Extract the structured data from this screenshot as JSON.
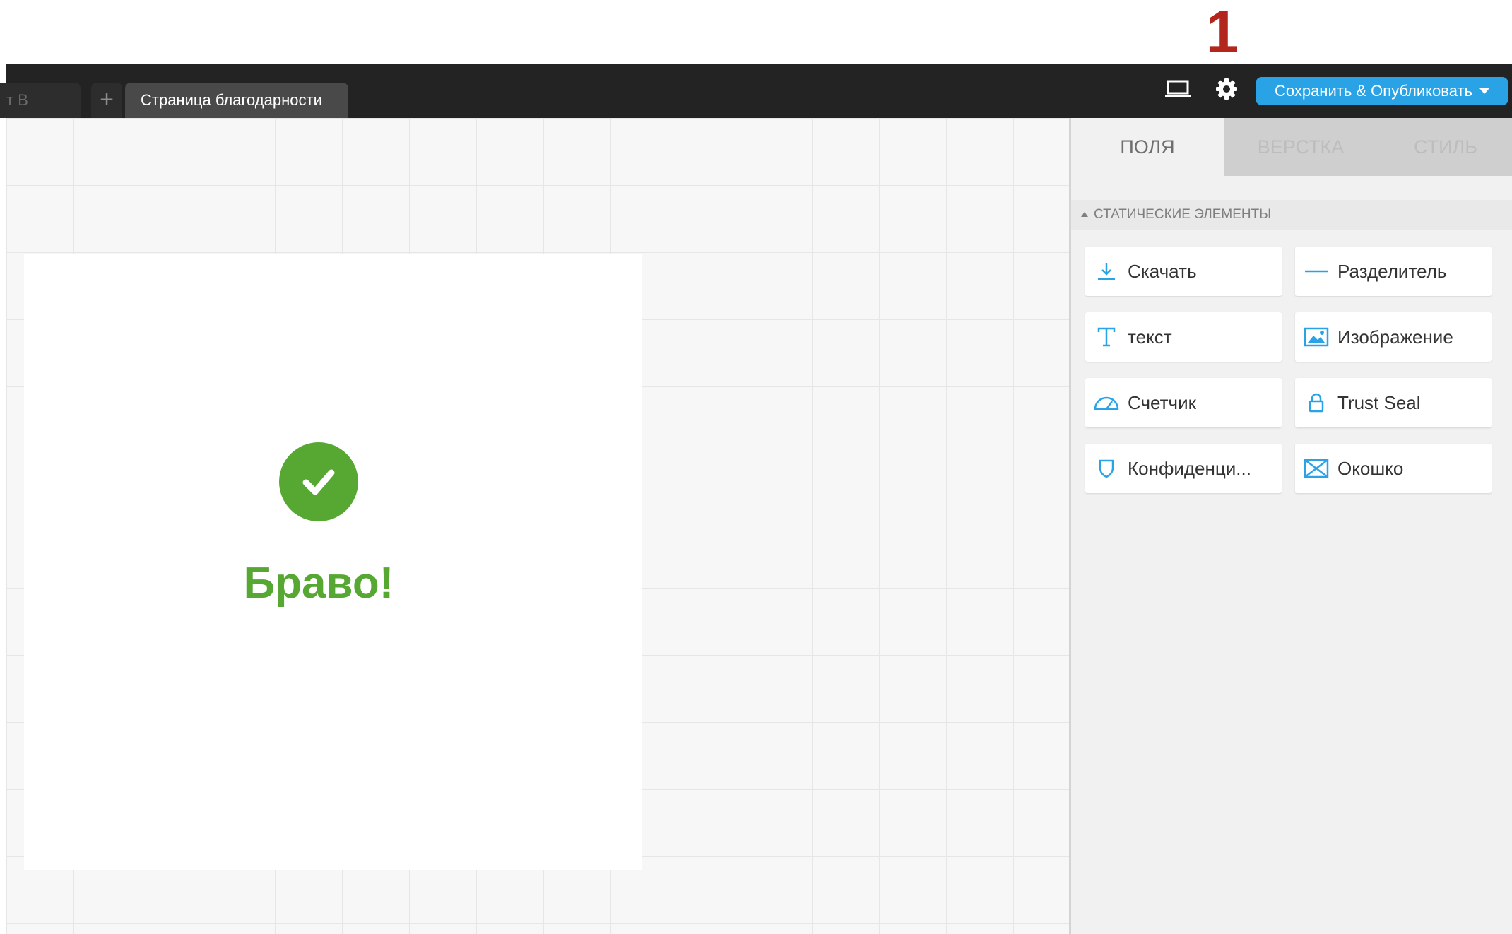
{
  "annotation": {
    "number": "1",
    "color": "#c62828"
  },
  "topbar": {
    "tabs": [
      {
        "label": "т В"
      },
      {
        "label": "+"
      },
      {
        "label": "Страница благодарности"
      }
    ],
    "publish_label": "Сохранить & Опубликовать",
    "icons": [
      "laptop-icon",
      "gear-icon",
      "caret-down-icon"
    ],
    "accent": "#2aa3e6"
  },
  "canvas": {
    "heading": "Браво!",
    "success_color": "#56a832"
  },
  "panel": {
    "tabs": [
      "ПОЛЯ",
      "ВЕРСТКА",
      "СТИЛЬ"
    ],
    "active_tab": "ПОЛЯ",
    "section_title": "СТАТИЧЕСКИЕ ЭЛЕМЕНТЫ",
    "elements": [
      {
        "label": "Скачать",
        "icon": "download-icon"
      },
      {
        "label": "Разделитель",
        "icon": "divider-icon"
      },
      {
        "label": "текст",
        "icon": "text-icon"
      },
      {
        "label": "Изображение",
        "icon": "image-icon"
      },
      {
        "label": "Счетчик",
        "icon": "gauge-icon"
      },
      {
        "label": "Trust Seal",
        "icon": "lock-icon"
      },
      {
        "label": "Конфиденци...",
        "icon": "shield-icon"
      },
      {
        "label": "Окошко",
        "icon": "envelope-icon"
      }
    ],
    "icon_color": "#2aa3e6"
  }
}
